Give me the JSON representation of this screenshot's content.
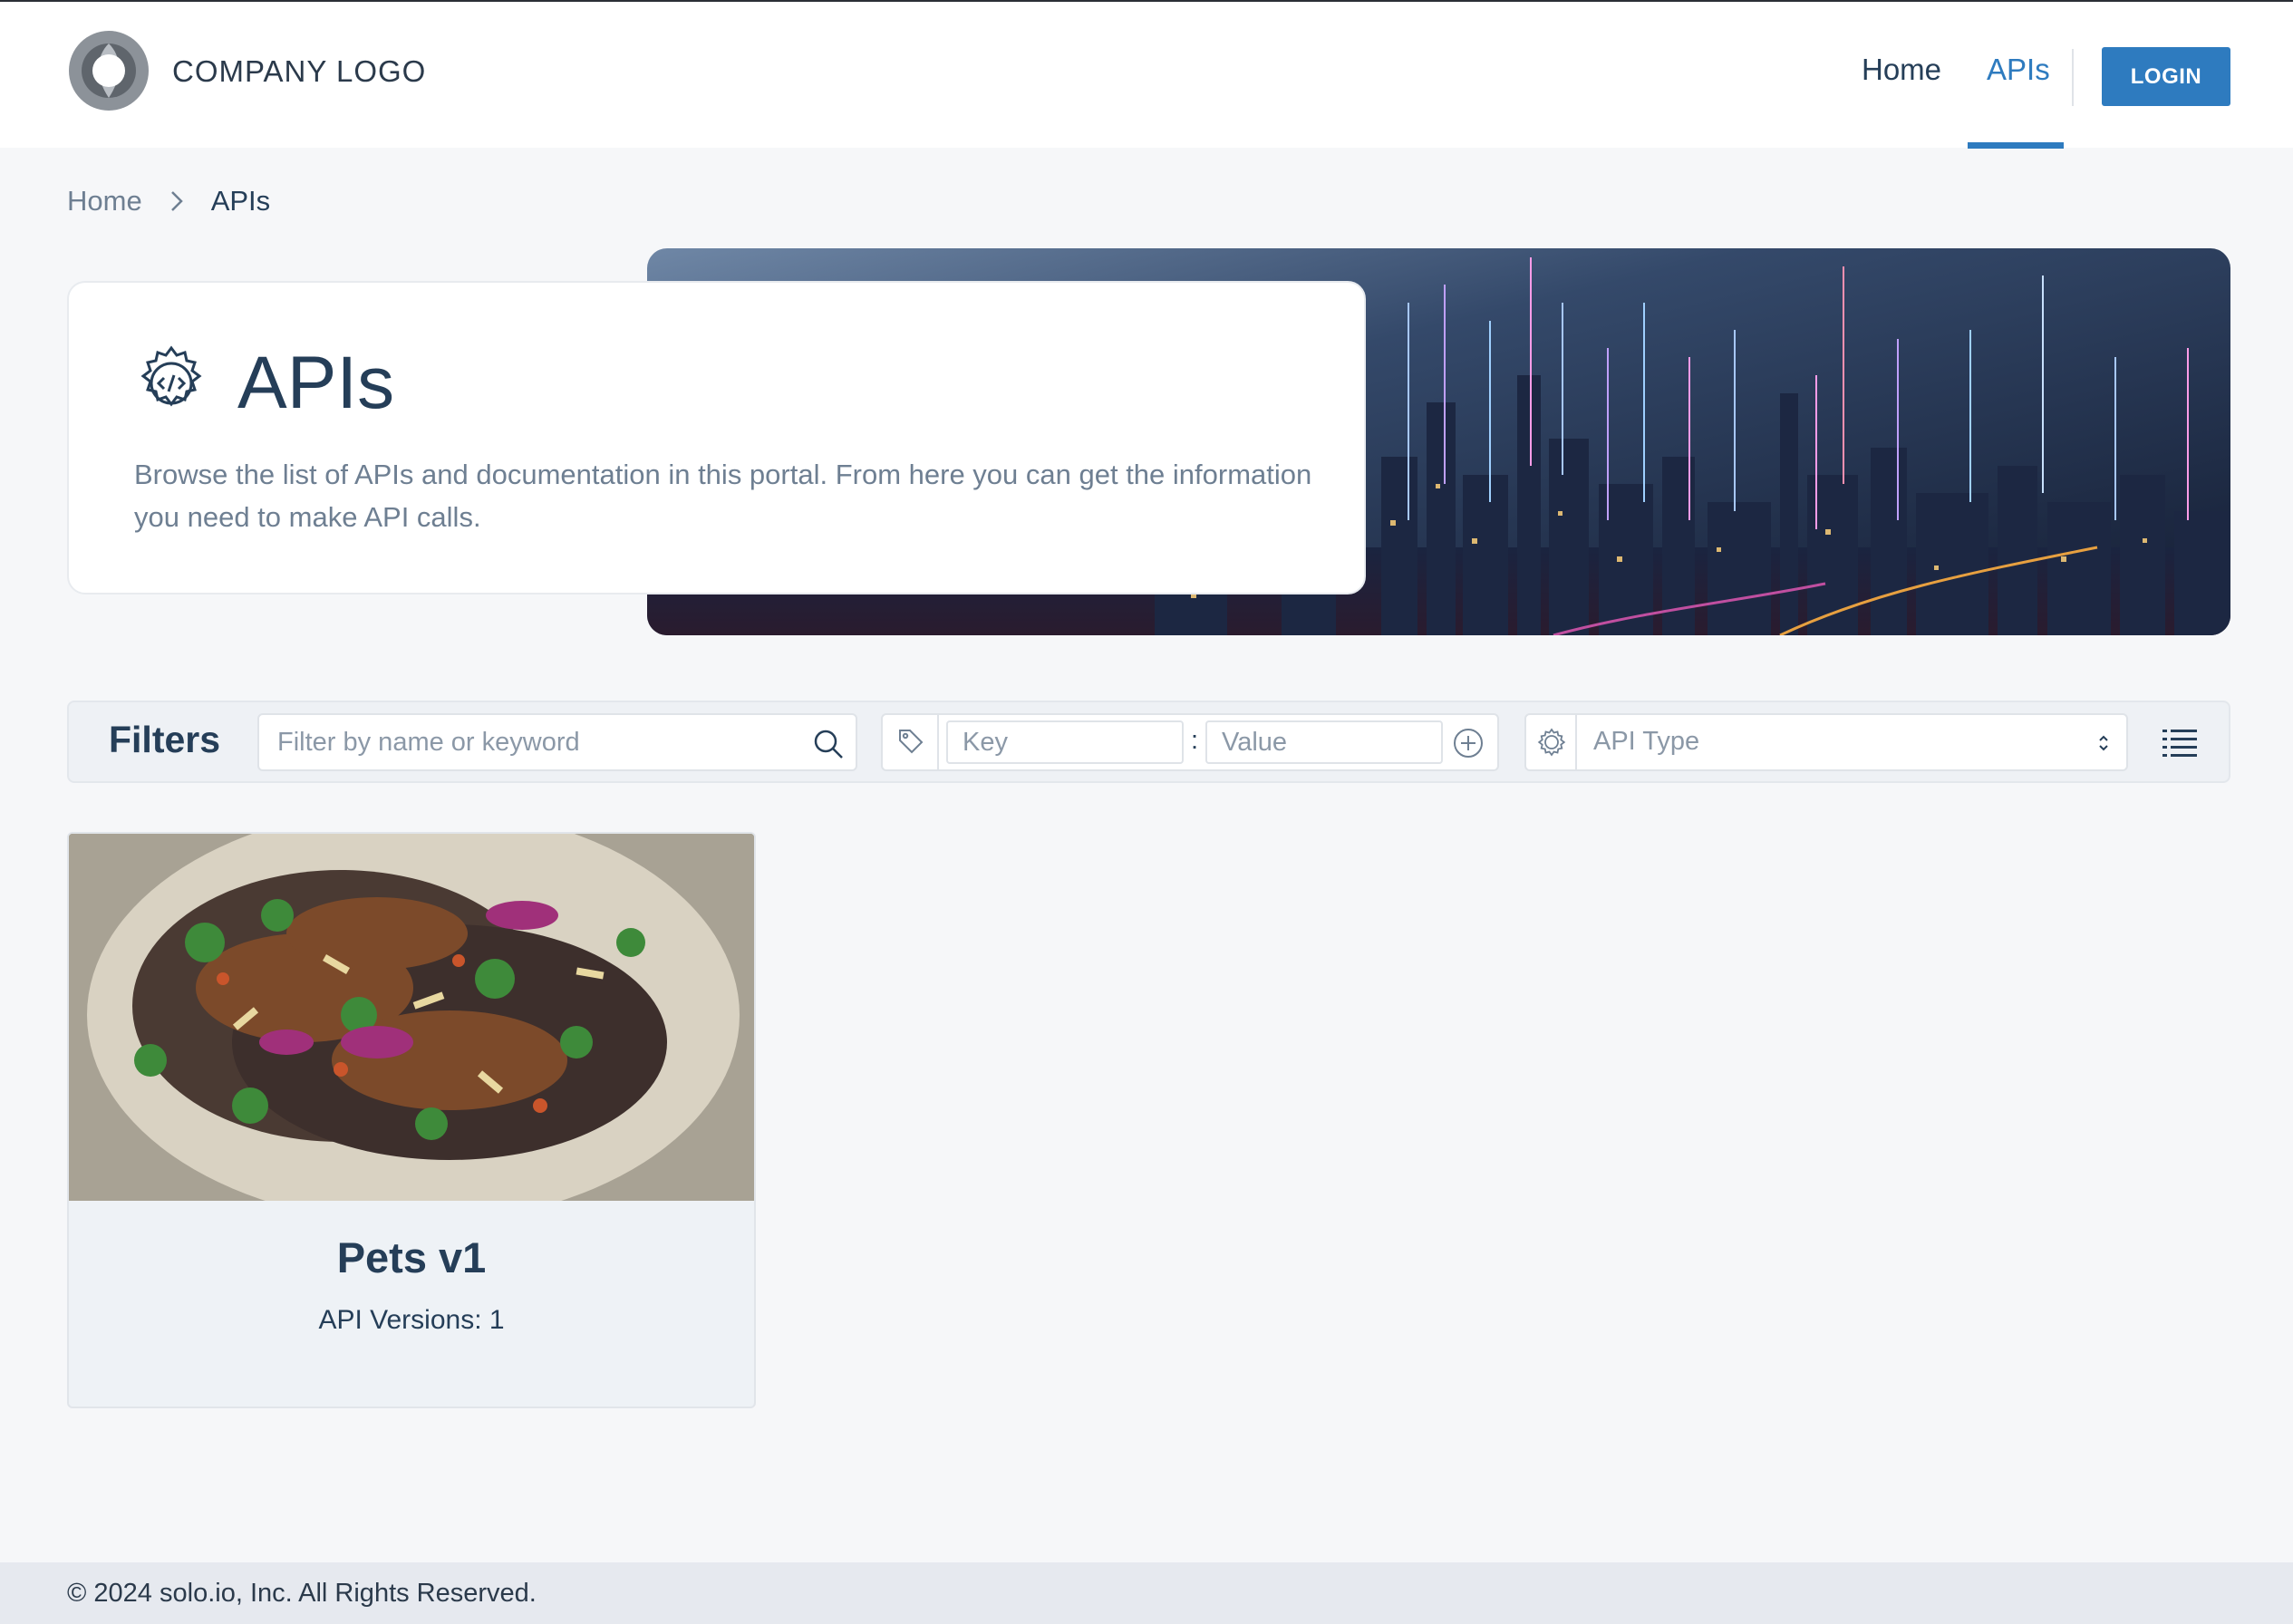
{
  "header": {
    "logo_text": "COMPANY LOGO",
    "nav": [
      {
        "label": "Home",
        "active": false
      },
      {
        "label": "APIs",
        "active": true
      }
    ],
    "login_label": "LOGIN"
  },
  "breadcrumb": {
    "home": "Home",
    "current": "APIs"
  },
  "hero": {
    "title": "APIs",
    "description": "Browse the list of APIs and documentation in this portal. From here you can get the information you need to make API calls.",
    "icon": "gear-code-icon",
    "background": "city-night-skyline-image"
  },
  "filters": {
    "title": "Filters",
    "search_placeholder": "Filter by name or keyword",
    "search_value": "",
    "key_placeholder": "Key",
    "value_placeholder": "Value",
    "separator": ":",
    "api_type_label": "API Type"
  },
  "apis": [
    {
      "title": "Pets v1",
      "versions_text": "API Versions: 1",
      "image": "tacos-food-image"
    }
  ],
  "footer": {
    "copyright": "© 2024 solo.io, Inc. All Rights Reserved."
  },
  "colors": {
    "accent": "#2e7bbf",
    "text_dark": "#253e58",
    "text_muted": "#6e7f92",
    "page_bg": "#f6f7f9",
    "footer_bg": "#e6e9ef"
  }
}
